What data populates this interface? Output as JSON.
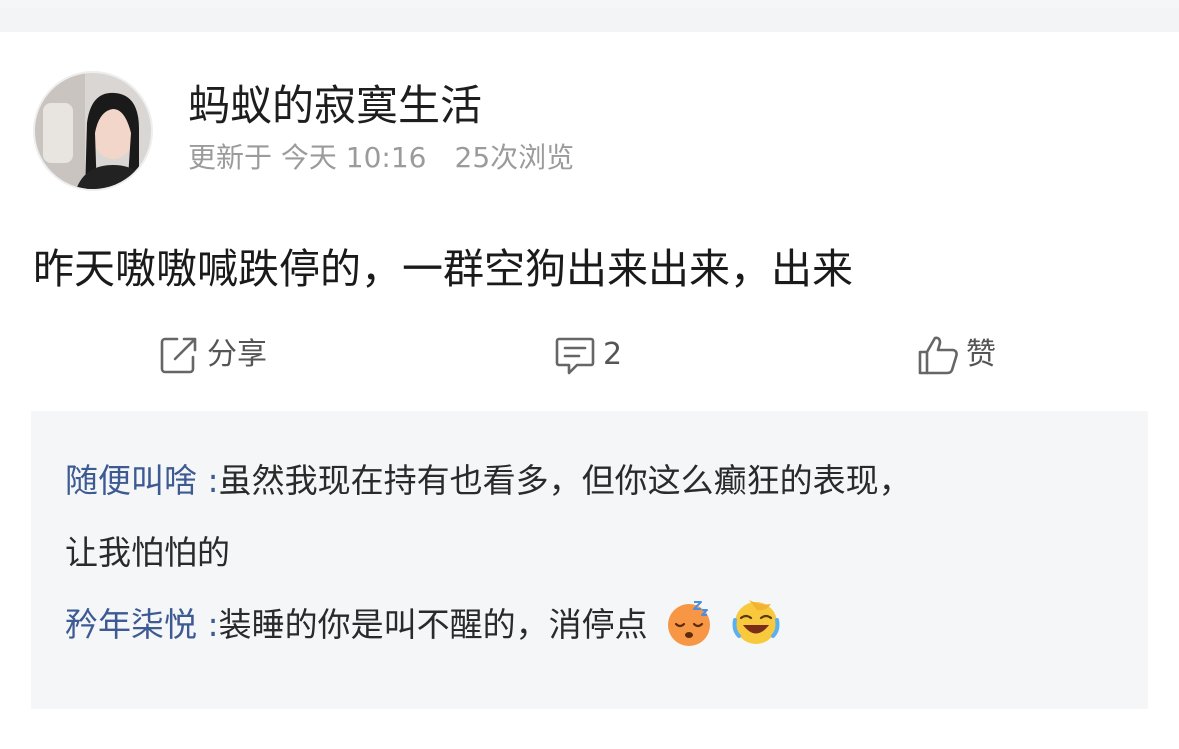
{
  "post": {
    "author": "蚂蚁的寂寞生活",
    "updated": "更新于 今天 10:16",
    "views": "25次浏览",
    "text": "昨天嗷嗷喊跌停的，一群空狗出来出来，出来"
  },
  "actions": {
    "share_label": "分享",
    "comment_count": "2",
    "like_label": "赞"
  },
  "comments": [
    {
      "user": "随便叫啥",
      "separator": ":",
      "line1": "虽然我现在持有也看多，但你这么癫狂的表现，",
      "line2": "让我怕怕的"
    },
    {
      "user": "矜年柒悦",
      "separator": ":",
      "text": "装睡的你是叫不醒的，消停点",
      "emojis": [
        "sleeping-face-emoji",
        "rolling-laughing-emoji"
      ]
    }
  ],
  "colors": {
    "username": "#3d5a93",
    "meta": "#9b9b9b",
    "comment_bg": "#f5f6f8"
  }
}
